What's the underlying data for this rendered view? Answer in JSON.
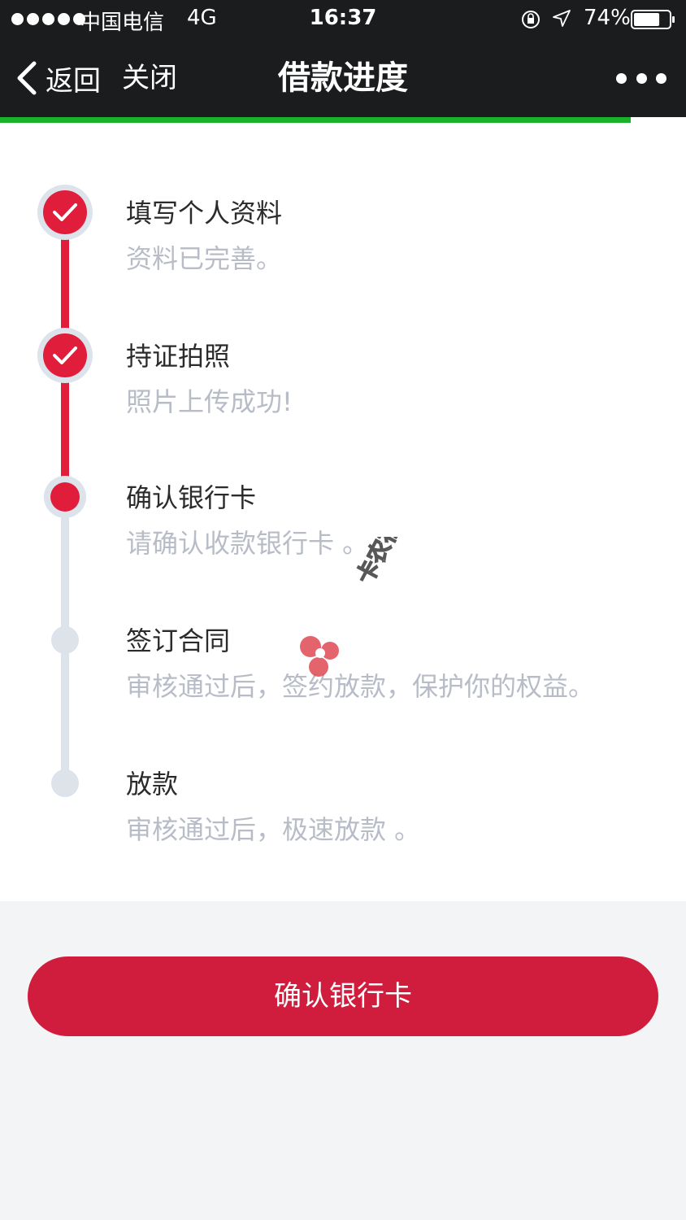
{
  "status_bar": {
    "carrier": "中国电信",
    "network": "4G",
    "time": "16:37",
    "battery": "74%",
    "battery_level": 0.74
  },
  "nav": {
    "back_label": "返回",
    "close_label": "关闭",
    "title": "借款进度"
  },
  "page_progress": 0.92,
  "steps": [
    {
      "title": "填写个人资料",
      "desc": "资料已完善。",
      "state": "done"
    },
    {
      "title": "持证拍照",
      "desc": "照片上传成功!",
      "state": "done"
    },
    {
      "title": "确认银行卡",
      "desc": "请确认收款银行卡 。",
      "state": "current"
    },
    {
      "title": "签订合同",
      "desc": "审核通过后，签约放款，保护你的权益。",
      "state": "todo"
    },
    {
      "title": "放款",
      "desc": "审核通过后，极速放款 。",
      "state": "todo"
    }
  ],
  "watermark_text": "卡农社区",
  "confirm_button": "确认银行卡",
  "colors": {
    "accent": "#e01d3a",
    "button": "#d11d3d",
    "progress": "#1ab22b",
    "inactive": "#dde3eb",
    "bar": "#1b1c1e"
  }
}
